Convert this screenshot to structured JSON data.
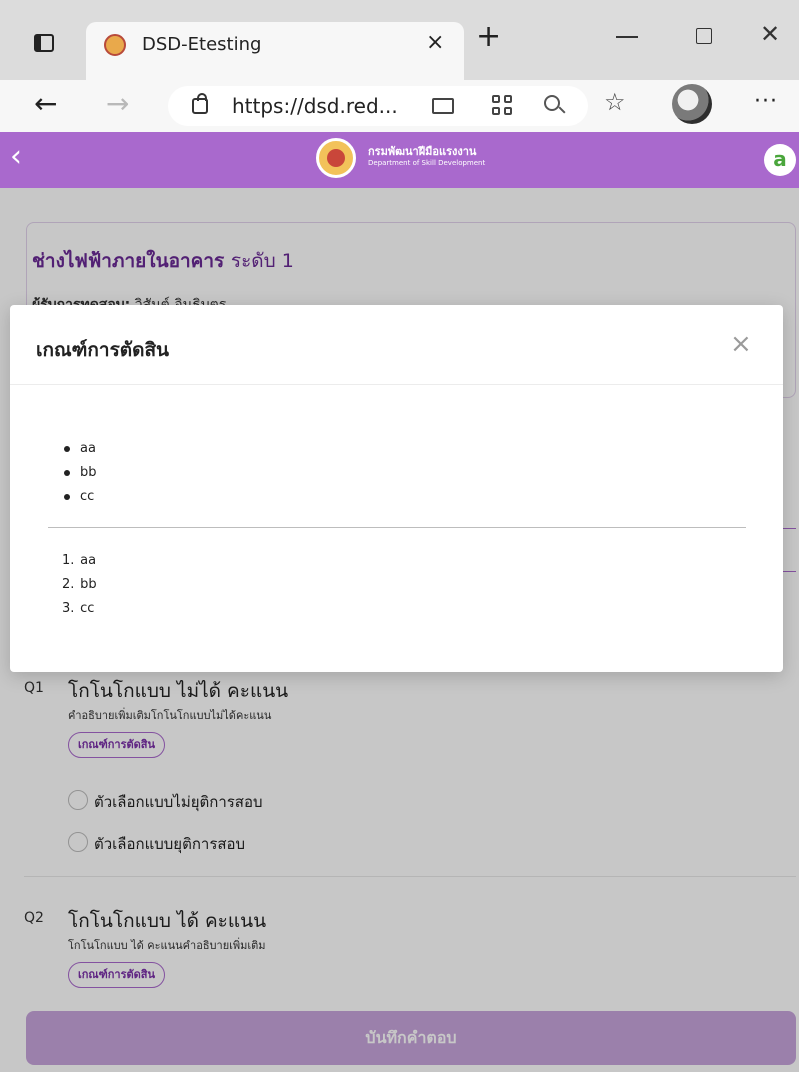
{
  "browser": {
    "tab_title": "DSD-Etesting",
    "url": "https://dsd.red...",
    "tab_close_glyph": "×",
    "new_tab_glyph": "+",
    "window_close_glyph": "✕",
    "back_glyph": "←",
    "forward_glyph": "→",
    "favorites_glyph": "☆",
    "more_glyph": "···"
  },
  "app_header": {
    "back_glyph": "‹",
    "brand_th": "กรมพัฒนาฝีมือแรงงาน",
    "brand_en": "Department of Skill Development",
    "user_initial": "a",
    "header_color": "#a969cd"
  },
  "course": {
    "name": "ช่างไฟฟ้าภายในอาคาร",
    "level": "ระดับ 1",
    "examinee_label": "ผู้รับการทดสอบ:",
    "examinee_name": "วิสันต์ อินธิบตร"
  },
  "modal": {
    "title": "เกณฑ์การตัดสิน",
    "close_glyph": "×",
    "bullet_items": [
      "aa",
      "bb",
      "cc"
    ],
    "numbered_items": [
      {
        "num": "1.",
        "text": "aa"
      },
      {
        "num": "2.",
        "text": "bb"
      },
      {
        "num": "3.",
        "text": "cc"
      }
    ]
  },
  "questions": [
    {
      "number": "Q1",
      "title": "โกโนโกแบบ ไม่ได้ คะแนน",
      "description": "คำอธิบายเพิ่มเติมโกโนโกแบบไม่ได้คะแนน",
      "criteria_label": "เกณฑ์การตัดสิน",
      "options": [
        "ตัวเลือกแบบไม่ยุติการสอบ",
        "ตัวเลือกแบบยุติการสอบ"
      ]
    },
    {
      "number": "Q2",
      "title": "โกโนโกแบบ ได้ คะแนน",
      "description": "โกโนโกแบบ ได้ คะแนนคำอธิบายเพิ่มเติม",
      "criteria_label": "เกณฑ์การตัดสิน",
      "options": []
    }
  ],
  "footer": {
    "submit_label": "บันทึกคำตอบ",
    "submit_color": "#c7a5dc"
  }
}
